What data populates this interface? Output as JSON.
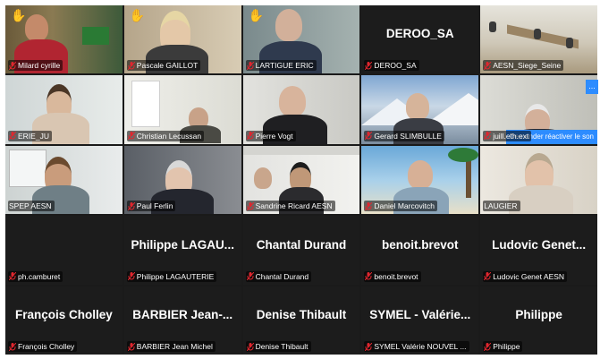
{
  "participants": [
    {
      "name": "Milard cyrille",
      "hand": true
    },
    {
      "name": "Pascale GAILLOT",
      "hand": true
    },
    {
      "name": "LARTIGUE ERIC",
      "hand": true
    },
    {
      "name": "DEROO_SA",
      "title": "DEROO_SA"
    },
    {
      "name": "AESN_Siege_Seine"
    },
    {
      "name": "ERIE_JU"
    },
    {
      "name": "Christian Lecussan"
    },
    {
      "name": "Pierre Vogt"
    },
    {
      "name": "Gerard SLIMBULLE"
    },
    {
      "name": "juill.eth.ext"
    },
    {
      "name": "SPEP AESN"
    },
    {
      "name": "Paul Ferlin"
    },
    {
      "name": "Sandrine Ricard AESN"
    },
    {
      "name": "Daniel Marcovitch"
    },
    {
      "name": "LAUGIER"
    },
    {
      "name": "ph.camburet"
    },
    {
      "name": "Philippe LAGAUTERIE",
      "title": "Philippe LAGAU..."
    },
    {
      "name": "Chantal Durand",
      "title": "Chantal Durand"
    },
    {
      "name": "benoit.brevot",
      "title": "benoit.brevot"
    },
    {
      "name": "Ludovic Genet AESN",
      "title": "Ludovic Genet..."
    },
    {
      "name": "François Cholley",
      "title": "François Cholley"
    },
    {
      "name": "BARBIER Jean Michel",
      "title": "BARBIER Jean-..."
    },
    {
      "name": "Denise Thibault",
      "title": "Denise Thibault"
    },
    {
      "name": "SYMEL Valérie NOUVEL ...",
      "title": "SYMEL - Valérie..."
    },
    {
      "name": "Philippe",
      "title": "Philippe"
    }
  ],
  "request_unmute_label": "Demander réactiver le son",
  "more_label": "...",
  "hand_icon": "raised-hand-icon",
  "mic_icon": "muted-mic-icon",
  "colors": {
    "active_border": "#2fa34a",
    "accent": "#2d8cff",
    "muted_mic": "#e0262e"
  }
}
